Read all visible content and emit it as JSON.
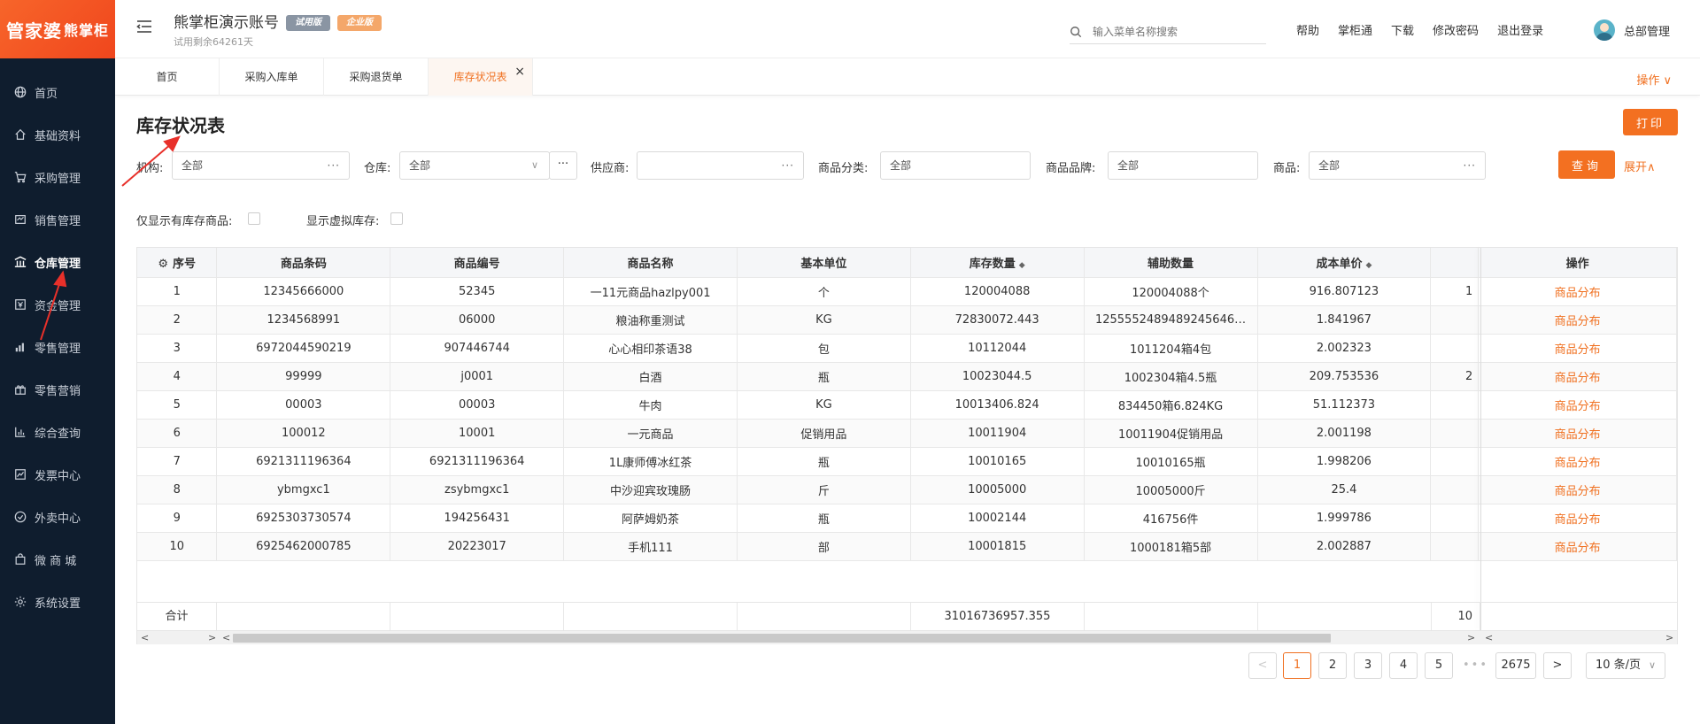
{
  "logo": {
    "part1": "管家婆",
    "part2": "熊掌柜"
  },
  "sidebar": {
    "items": [
      {
        "label": "首页",
        "icon": "globe-icon"
      },
      {
        "label": "基础资料",
        "icon": "home-icon"
      },
      {
        "label": "采购管理",
        "icon": "cart-icon"
      },
      {
        "label": "销售管理",
        "icon": "sales-icon"
      },
      {
        "label": "仓库管理",
        "icon": "warehouse-icon",
        "active": true
      },
      {
        "label": "资金管理",
        "icon": "money-icon"
      },
      {
        "label": "零售管理",
        "icon": "chart-icon"
      },
      {
        "label": "零售营销",
        "icon": "gift-icon"
      },
      {
        "label": "综合查询",
        "icon": "bar-chart-icon"
      },
      {
        "label": "发票中心",
        "icon": "line-chart-icon"
      },
      {
        "label": "外卖中心",
        "icon": "delivery-icon"
      },
      {
        "label": "微 商 城",
        "icon": "bag-icon"
      },
      {
        "label": "系统设置",
        "icon": "gear-icon"
      }
    ]
  },
  "header": {
    "account_title": "熊掌柜演示账号",
    "badge_trial": "试用版",
    "badge_enterprise": "企业版",
    "trial_remaining": "试用剩余64261天",
    "search_placeholder": "输入菜单名称搜索",
    "links": [
      "帮助",
      "掌柜通",
      "下载",
      "修改密码",
      "退出登录"
    ],
    "user_name": "总部管理"
  },
  "tabs": {
    "items": [
      {
        "label": "首页"
      },
      {
        "label": "采购入库单"
      },
      {
        "label": "采购退货单"
      },
      {
        "label": "库存状况表",
        "active": true
      }
    ],
    "close_glyph": "×",
    "ops_label": "操作 ∨"
  },
  "page": {
    "title": "库存状况表",
    "print_label": "打印",
    "query_label": "查询",
    "expand_label": "展开∧"
  },
  "filters": {
    "org": {
      "label": "机构:",
      "value": "全部"
    },
    "warehouse": {
      "label": "仓库:",
      "value": "全部"
    },
    "supplier": {
      "label": "供应商:",
      "value": ""
    },
    "category": {
      "label": "商品分类:",
      "value": "全部"
    },
    "brand": {
      "label": "商品品牌:",
      "value": "全部"
    },
    "product": {
      "label": "商品:",
      "value": "全部"
    },
    "only_in_stock_label": "仅显示有库存商品:",
    "show_virtual_label": "显示虚拟库存:",
    "dots": "···",
    "chevron": "∨"
  },
  "table": {
    "headers": [
      "序号",
      "商品条码",
      "商品编号",
      "商品名称",
      "基本单位",
      "库存数量",
      "辅助数量",
      "成本单价",
      "",
      "操作"
    ],
    "rows": [
      [
        "1",
        "12345666000",
        "52345",
        "一11元商品hazlpy001",
        "个",
        "120004088",
        "120004088个",
        "916.807123",
        "1",
        "商品分布"
      ],
      [
        "2",
        "1234568991",
        "06000",
        "粮油称重测试",
        "KG",
        "72830072.443",
        "1255552489489245646…",
        "1.841967",
        "",
        "商品分布"
      ],
      [
        "3",
        "6972044590219",
        "907446744",
        "心心相印茶语38",
        "包",
        "10112044",
        "1011204箱4包",
        "2.002323",
        "",
        "商品分布"
      ],
      [
        "4",
        "99999",
        "j0001",
        "白酒",
        "瓶",
        "10023044.5",
        "1002304箱4.5瓶",
        "209.753536",
        "2",
        "商品分布"
      ],
      [
        "5",
        "00003",
        "00003",
        "牛肉",
        "KG",
        "10013406.824",
        "834450箱6.824KG",
        "51.112373",
        "",
        "商品分布"
      ],
      [
        "6",
        "100012",
        "10001",
        "一元商品",
        "促销用品",
        "10011904",
        "10011904促销用品",
        "2.001198",
        "",
        "商品分布"
      ],
      [
        "7",
        "6921311196364",
        "6921311196364",
        "1L康师傅冰红茶",
        "瓶",
        "10010165",
        "10010165瓶",
        "1.998206",
        "",
        "商品分布"
      ],
      [
        "8",
        "ybmgxc1",
        "zsybmgxc1",
        "中沙迎宾玫瑰肠",
        "斤",
        "10005000",
        "10005000斤",
        "25.4",
        "",
        "商品分布"
      ],
      [
        "9",
        "6925303730574",
        "194256431",
        "阿萨姆奶茶",
        "瓶",
        "10002144",
        "416756件",
        "1.999786",
        "",
        "商品分布"
      ],
      [
        "10",
        "6925462000785",
        "20223017",
        "手机111",
        "部",
        "10001815",
        "1000181箱5部",
        "2.002887",
        "",
        "商品分布"
      ]
    ],
    "total_label": "合计",
    "total_qty": "31016736957.355",
    "total_extra": "10"
  },
  "pagination": {
    "prev": "<",
    "next": ">",
    "pages": [
      "1",
      "2",
      "3",
      "4",
      "5"
    ],
    "ellipsis": "•••",
    "last": "2675",
    "page_size": "10 条/页"
  },
  "colors": {
    "accent": "#f37021",
    "sidebar_bg": "#0f1d2e"
  }
}
